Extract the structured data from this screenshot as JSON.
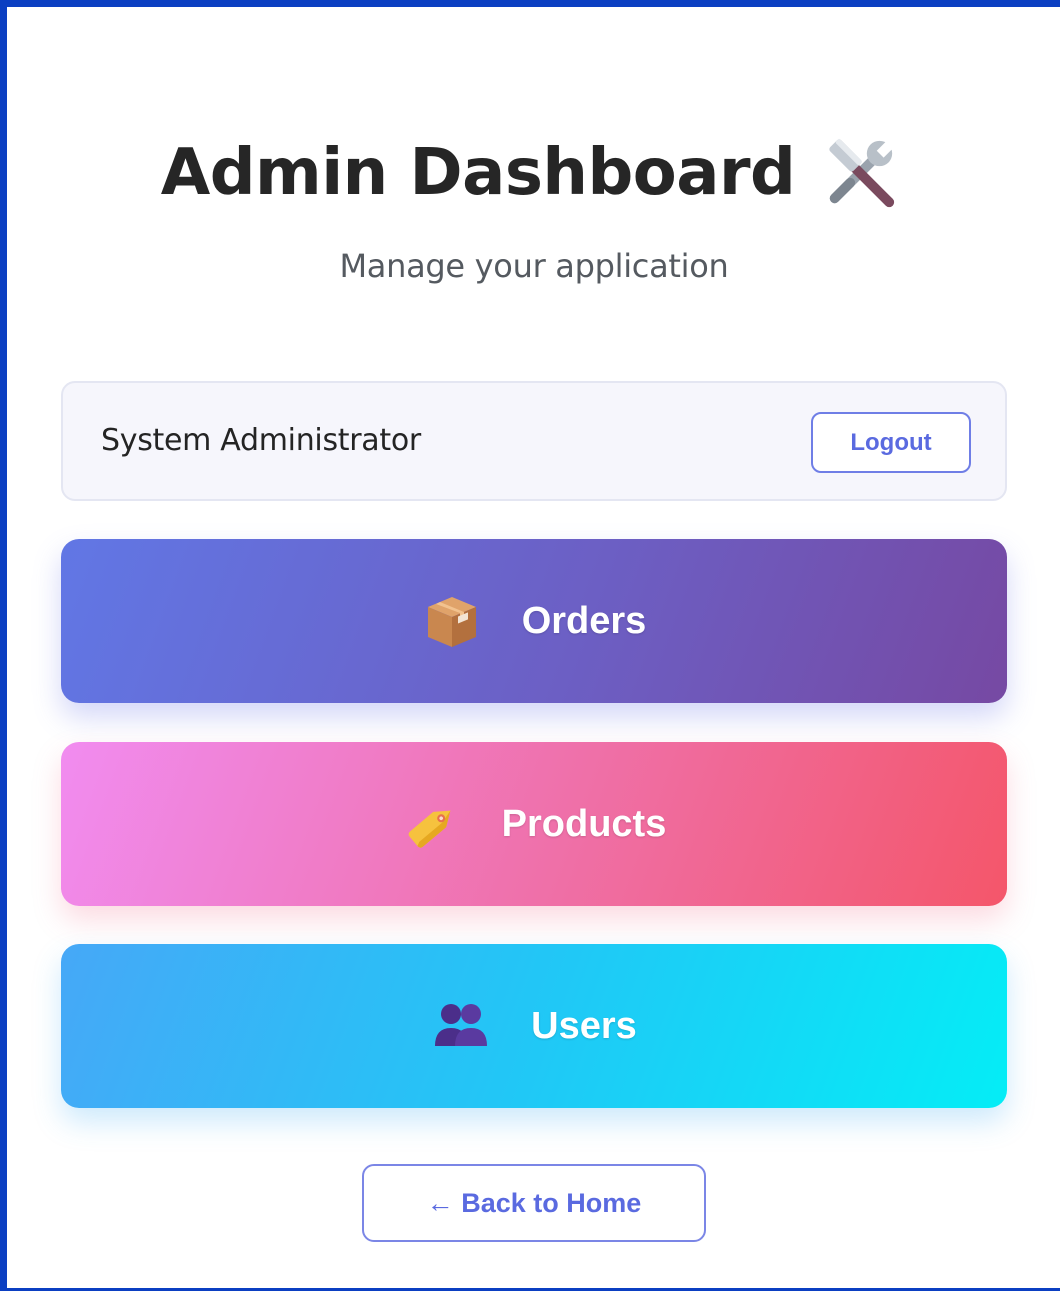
{
  "header": {
    "title": "Admin Dashboard",
    "title_icon": "tools-icon",
    "subtitle": "Manage your application"
  },
  "admin_card": {
    "name": "System Administrator",
    "logout_label": "Logout"
  },
  "nav": [
    {
      "label": "Orders",
      "icon": "package-icon",
      "gradient": [
        "#6177e5",
        "#7649a3"
      ]
    },
    {
      "label": "Products",
      "icon": "tag-icon",
      "gradient": [
        "#f18cf0",
        "#f4566a"
      ]
    },
    {
      "label": "Users",
      "icon": "users-icon",
      "gradient": [
        "#46a8f7",
        "#04edf6"
      ]
    }
  ],
  "back_label": "← Back to Home",
  "colors": {
    "frame": "#0b3fc2",
    "accent": "#5a6ae0",
    "title": "#262626"
  }
}
